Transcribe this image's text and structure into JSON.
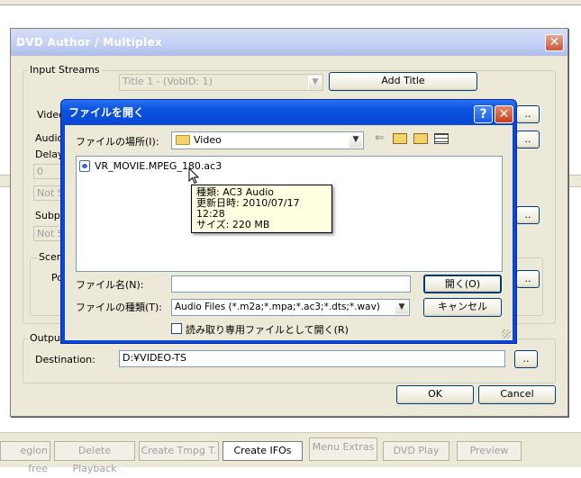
{
  "parent": {
    "title": "DVD Author / Multiplex",
    "close_glyph": "✕",
    "input_streams_label": "Input Streams",
    "title_select_value": "Title 1 - (VobID: 1)",
    "add_title_label": "Add Title",
    "video_label": "Video",
    "audio_label": "Audio",
    "delay_label": "Delay",
    "delay_value": "0",
    "audio_stream_value": "Not S",
    "subpic_label": "Subpic",
    "subpic_value": "Not S",
    "scene_label": "Scen",
    "po_label": "Po",
    "dots_label": "..",
    "output_label": "Output",
    "destination_label": "Destination:",
    "destination_value": "D:¥VIDEO-TS",
    "ok_label": "OK",
    "cancel_label": "Cancel"
  },
  "dialog": {
    "title": "ファイルを開く",
    "help_glyph": "?",
    "close_glyph": "✕",
    "look_in_label": "ファイルの場所(I):",
    "look_in_value": "Video",
    "files": [
      {
        "name": "VR_MOVIE.MPEG_180.ac3"
      }
    ],
    "tooltip": {
      "type_line": "種類: AC3 Audio",
      "date_line": "更新日時: 2010/07/17 12:28",
      "size_line": "サイズ: 220 MB"
    },
    "filename_label": "ファイル名(N):",
    "filename_value": "",
    "filetype_label": "ファイルの種類(T):",
    "filetype_value": "Audio Files (*.m2a;*.mpa;*.ac3;*.dts;*.wav)",
    "readonly_label": "読み取り専用ファイルとして開く(R)",
    "open_label": "開く(O)",
    "cancel_label": "キャンセル"
  },
  "toolbar": {
    "buttons": [
      {
        "label": "egion free"
      },
      {
        "label": "Delete Playback"
      },
      {
        "label": "Create Tmpg T."
      },
      {
        "label": "Create IFOs"
      },
      {
        "label": "Menu Extras"
      },
      {
        "label": "DVD Play"
      },
      {
        "label": "Preview"
      }
    ]
  },
  "colors": {
    "xp_blue": "#0a46d8",
    "face": "#ece9d8",
    "tooltip_bg": "#ffffe1"
  }
}
